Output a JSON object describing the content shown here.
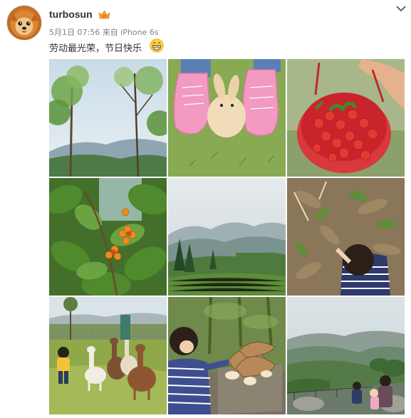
{
  "post": {
    "username": "turbosun",
    "meta": "5月1日 07:56 来自 iPhone 6s",
    "text": "劳动最光荣，节日快乐",
    "icons": {
      "avatar": "pomeranian-avatar",
      "vip": "vip-crown-badge-icon",
      "menu": "chevron-down-icon",
      "emoji": "grinning-emoji-icon"
    }
  },
  "photos": [
    {
      "name": "photo-trees-sky"
    },
    {
      "name": "photo-rabbit-pink-shoes"
    },
    {
      "name": "photo-cherries-basket"
    },
    {
      "name": "photo-cherry-tree"
    },
    {
      "name": "photo-mountain-tea-field"
    },
    {
      "name": "photo-child-picking"
    },
    {
      "name": "photo-alpacas-child"
    },
    {
      "name": "photo-child-bamboo-shoots"
    },
    {
      "name": "photo-mountain-view"
    }
  ],
  "colors": {
    "username": "#333333",
    "meta": "#808080",
    "accent": "#eb7350"
  }
}
